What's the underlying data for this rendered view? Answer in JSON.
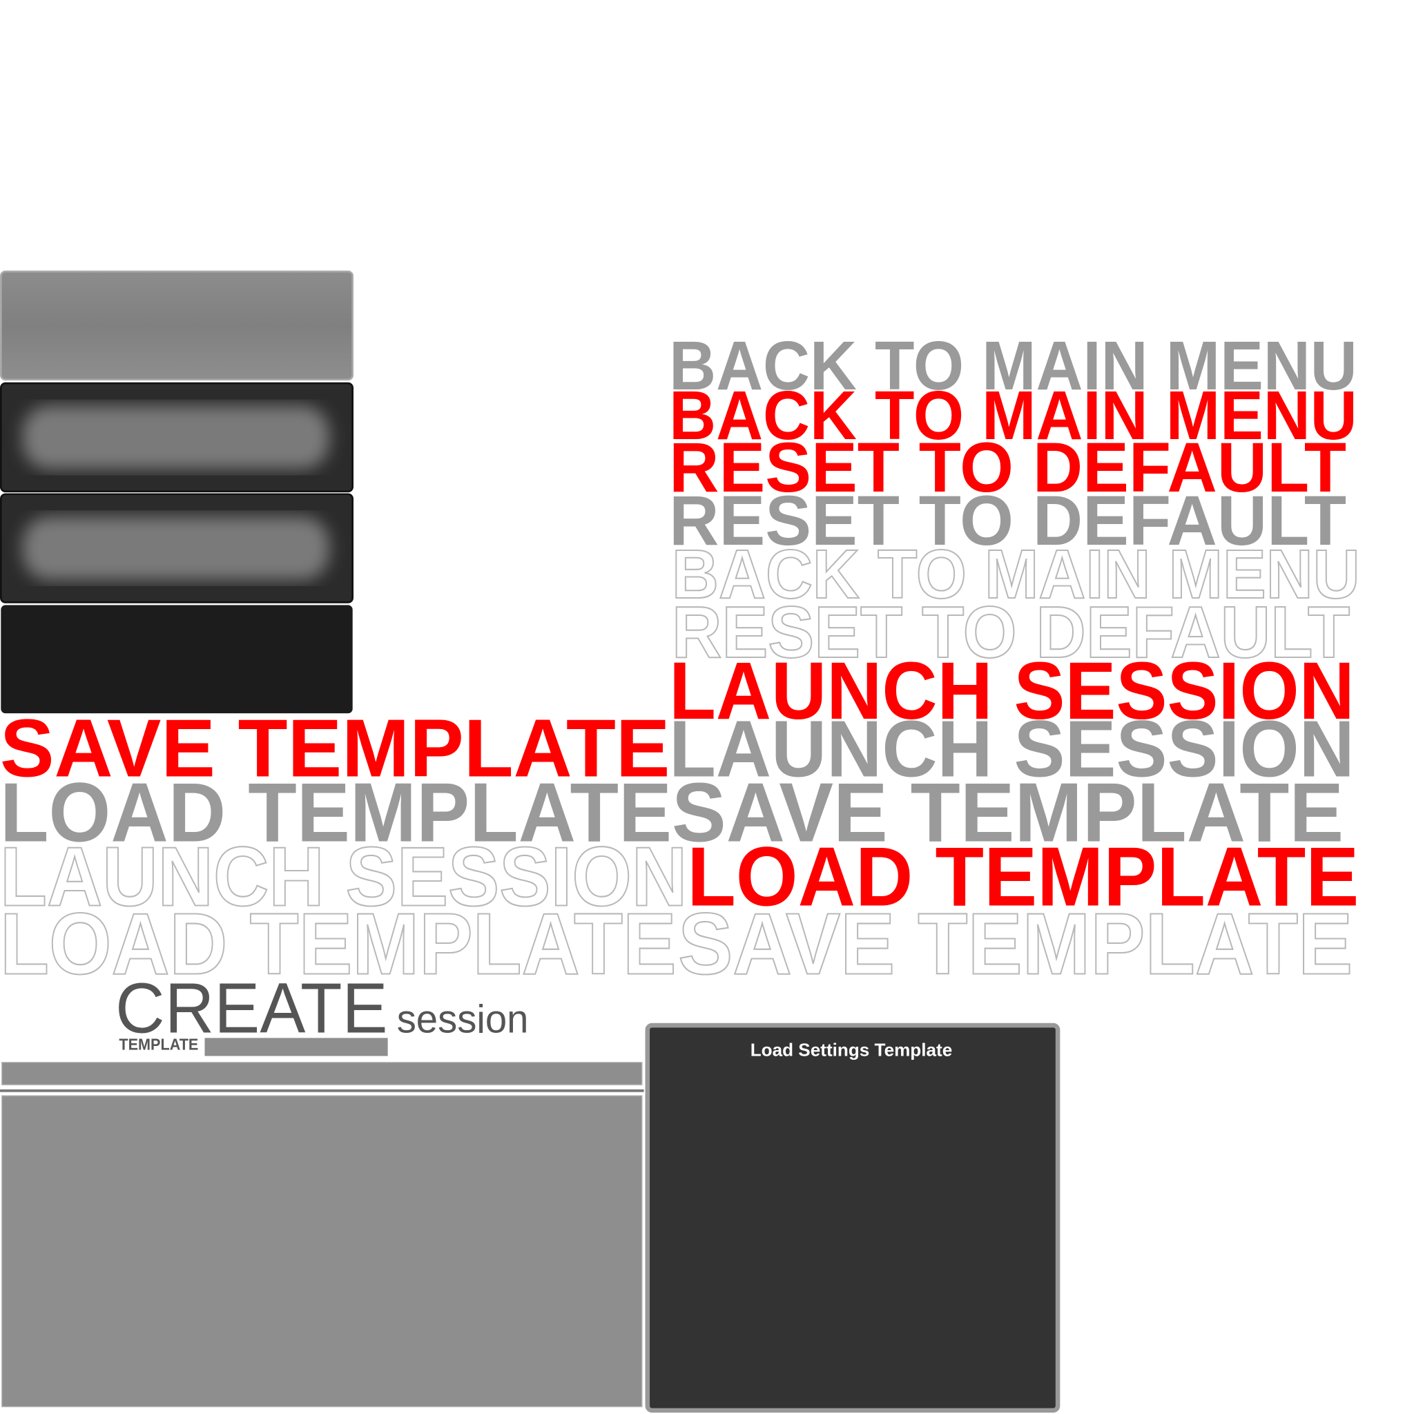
{
  "labels": [
    "BACK TO MAIN MENU",
    "BACK TO MAIN MENU",
    "RESET TO DEFAULT",
    "RESET TO DEFAULT",
    "BACK TO MAIN MENU",
    "RESET TO DEFAULT",
    "LAUNCH SESSION",
    "SAVE TEMPLATE",
    "LAUNCH SESSION",
    "LOAD TEMPLATE",
    "SAVE TEMPLATE",
    "LAUNCH SESSION",
    "LOAD TEMPLATE",
    "LOAD TEMPLATE",
    "SAVE TEMPLATE"
  ],
  "header": {
    "create": "CREATE",
    "session": "session",
    "template": "TEMPLATE"
  },
  "dialog": {
    "title": "Load Settings Template"
  },
  "colors": {
    "accent": "#ff0000",
    "muted": "#9a9a9a",
    "panel": "#333333"
  }
}
